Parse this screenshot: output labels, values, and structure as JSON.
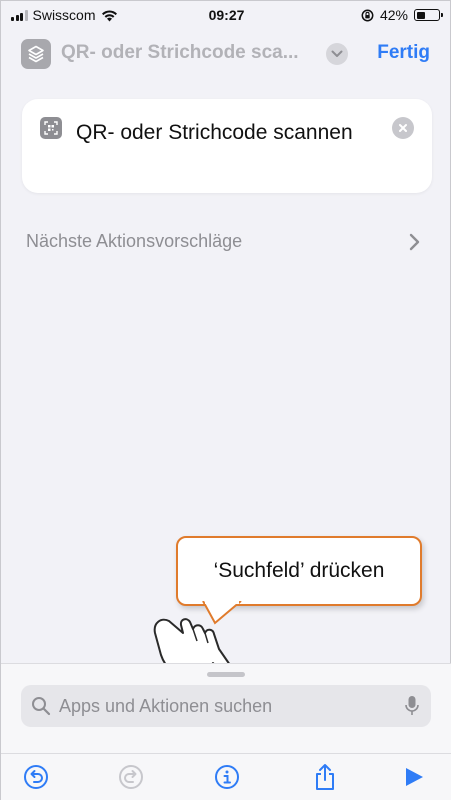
{
  "status_bar": {
    "carrier": "Swisscom",
    "time": "09:27",
    "battery_percent": "42%",
    "battery_level": 0.42
  },
  "nav": {
    "title": "QR- oder Strichcode sca...",
    "done_label": "Fertig",
    "accent_color": "#2f7cf6"
  },
  "action": {
    "title": "QR- oder Strichcode scannen"
  },
  "suggestions": {
    "label": "Nächste Aktionsvorschläge"
  },
  "callout": {
    "text": "‘Suchfeld’ drücken",
    "border_color": "#e07b2c"
  },
  "search": {
    "placeholder": "Apps und Aktionen suchen"
  },
  "toolbar": {
    "icons": [
      "undo-icon",
      "redo-icon",
      "info-icon",
      "share-icon",
      "play-icon"
    ]
  }
}
